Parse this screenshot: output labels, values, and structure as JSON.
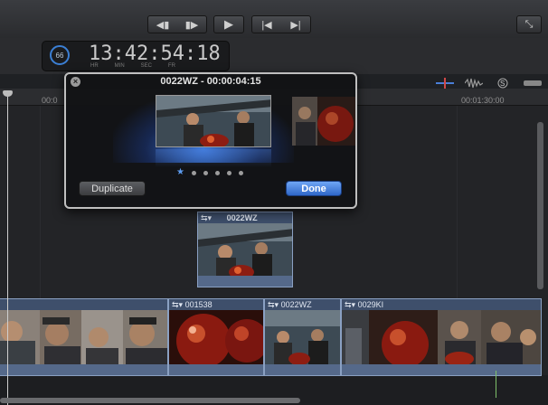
{
  "transport": {
    "prev_next_label": "◀◀ ▶▶",
    "play_label": "▶",
    "skip_label": "|◀ ▶|",
    "fullscreen_label": "⤡"
  },
  "timecode": {
    "dial_value": "66",
    "time": "13:42:54:18",
    "units": [
      "HR",
      "MIN",
      "SEC",
      "FR"
    ]
  },
  "ruler": {
    "left_label": "00:0",
    "right_label": "00:01:30:00"
  },
  "popover": {
    "title": "0022WZ - 00:00:04:15",
    "close_label": "×",
    "page_count": 6,
    "active_page": 0,
    "duplicate_label": "Duplicate",
    "done_label": "Done"
  },
  "clips": {
    "connected": {
      "name": "0022WZ"
    },
    "primary": [
      {
        "name": ""
      },
      {
        "name": "001538"
      },
      {
        "name": "0022WZ"
      },
      {
        "name": "0029KI"
      }
    ]
  },
  "colors": {
    "accent": "#3b7fd4",
    "clip": "#4b5d78",
    "done_button": "#2f67c8"
  }
}
